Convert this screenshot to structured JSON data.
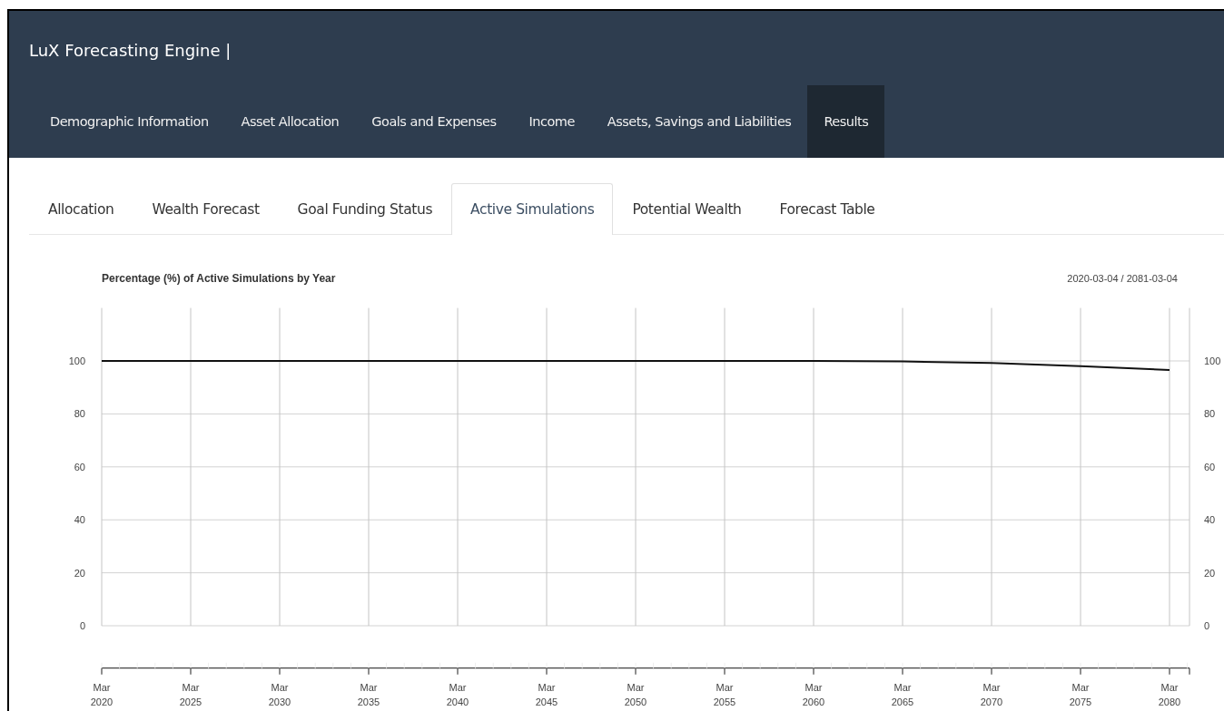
{
  "app": {
    "title": "LuX Forecasting Engine |"
  },
  "nav": [
    {
      "label": "Demographic Information",
      "selected": false
    },
    {
      "label": "Asset Allocation",
      "selected": false
    },
    {
      "label": "Goals and Expenses",
      "selected": false
    },
    {
      "label": "Income",
      "selected": false
    },
    {
      "label": "Assets, Savings and Liabilities",
      "selected": false
    },
    {
      "label": "Results",
      "selected": true
    }
  ],
  "tabs": [
    {
      "label": "Allocation",
      "selected": false
    },
    {
      "label": "Wealth Forecast",
      "selected": false
    },
    {
      "label": "Goal Funding Status",
      "selected": false
    },
    {
      "label": "Active Simulations",
      "selected": true
    },
    {
      "label": "Potential Wealth",
      "selected": false
    },
    {
      "label": "Forecast Table",
      "selected": false
    }
  ],
  "panel": {
    "date_range": "2020-03-04 / 2081-03-04",
    "chart_data": {
      "type": "line",
      "title": "Percentage (%) of Active Simulations by Year",
      "categories": [
        "Mar 2020",
        "Mar 2025",
        "Mar 2030",
        "Mar 2035",
        "Mar 2040",
        "Mar 2045",
        "Mar 2050",
        "Mar 2055",
        "Mar 2060",
        "Mar 2065",
        "Mar 2070",
        "Mar 2075",
        "Mar 2080"
      ],
      "grid": true,
      "series": [
        {
          "color": "#111111",
          "values": [
            100,
            100,
            100,
            100,
            100,
            100,
            100,
            100,
            100,
            99.8,
            99.2,
            98,
            96.6
          ]
        }
      ],
      "ylim": [
        -16,
        120
      ],
      "yticks": [
        {
          "value": 0,
          "label": "0"
        },
        {
          "value": 20,
          "label": "20"
        },
        {
          "value": 40,
          "label": "40"
        },
        {
          "value": 60,
          "label": "60"
        },
        {
          "value": 80,
          "label": "80"
        },
        {
          "value": 100,
          "label": "100"
        }
      ]
    },
    "right_axis_labels": [
      "100",
      "80",
      "60",
      "40",
      "20",
      "0"
    ]
  }
}
